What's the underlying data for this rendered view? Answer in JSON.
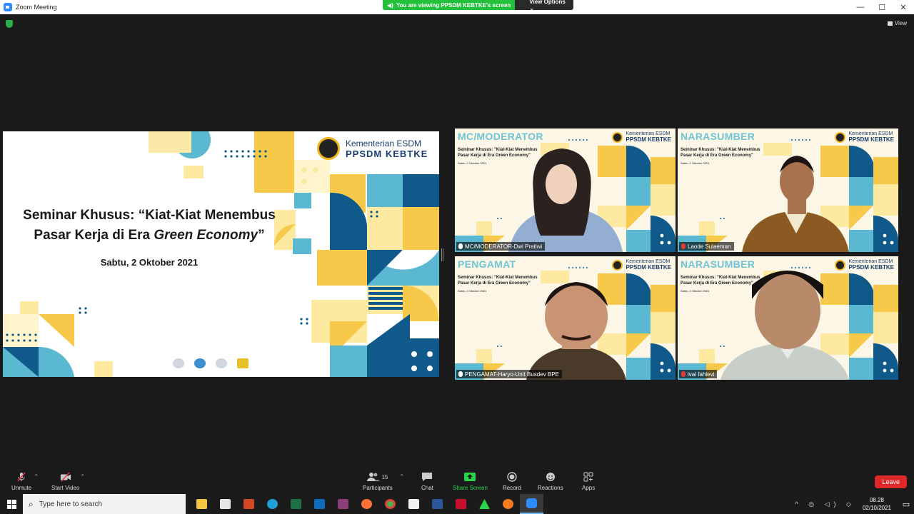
{
  "window": {
    "title": "Zoom Meeting",
    "minimize": "—",
    "maximize": "☐",
    "close": "✕"
  },
  "share_banner": {
    "text": "You are viewing PPSDM KEBTKE's screen",
    "options": "View Options ⌄"
  },
  "view_button": {
    "label": "View"
  },
  "slide": {
    "brand_line1": "Kementerian ESDM",
    "brand_line2": "PPSDM KEBTKE",
    "title_line1": "Seminar Khusus: “Kiat-Kiat Menembus",
    "title_line2_a": "Pasar Kerja di Era ",
    "title_line2_b": "Green Economy",
    "title_line2_c": "”",
    "date": "Sabtu, 2 Oktober 2021"
  },
  "tiles": [
    {
      "role": "MC/MODERATOR",
      "name": "MC/MODERATOR-Dwi Pratiwi",
      "muted": false
    },
    {
      "role": "NARASUMBER",
      "name": "Laode Sulaeman",
      "muted": true
    },
    {
      "role": "PENGAMAT",
      "name": "PENGAMAT-Haryo-Unit Busdev BPE",
      "muted": false
    },
    {
      "role": "NARASUMBER",
      "name": "ival fahlevi",
      "muted": true
    }
  ],
  "tile_slide": {
    "brand_line1": "Kementerian ESDM",
    "brand_line2": "PPSDM KEBTKE",
    "title_a": "Seminar Khusus: \"Kiat-Kiat Menembus",
    "title_b": "Pasar Kerja di Era Green Economy\"",
    "date": "Sabtu, 2 Oktober 2021"
  },
  "toolbar": {
    "unmute": "Unmute",
    "start_video": "Start Video",
    "participants": "Participants",
    "participants_count": "15",
    "chat": "Chat",
    "share_screen": "Share Screen",
    "record": "Record",
    "reactions": "Reactions",
    "apps": "Apps",
    "leave": "Leave"
  },
  "taskbar": {
    "search_placeholder": "Type here to search",
    "time": "08.28",
    "date": "02/10/2021"
  },
  "colors": {
    "zoom_blue": "#2D8CFF",
    "share_green": "#23c03a",
    "leave_red": "#e02828",
    "active_speaker": "#f5e300"
  }
}
